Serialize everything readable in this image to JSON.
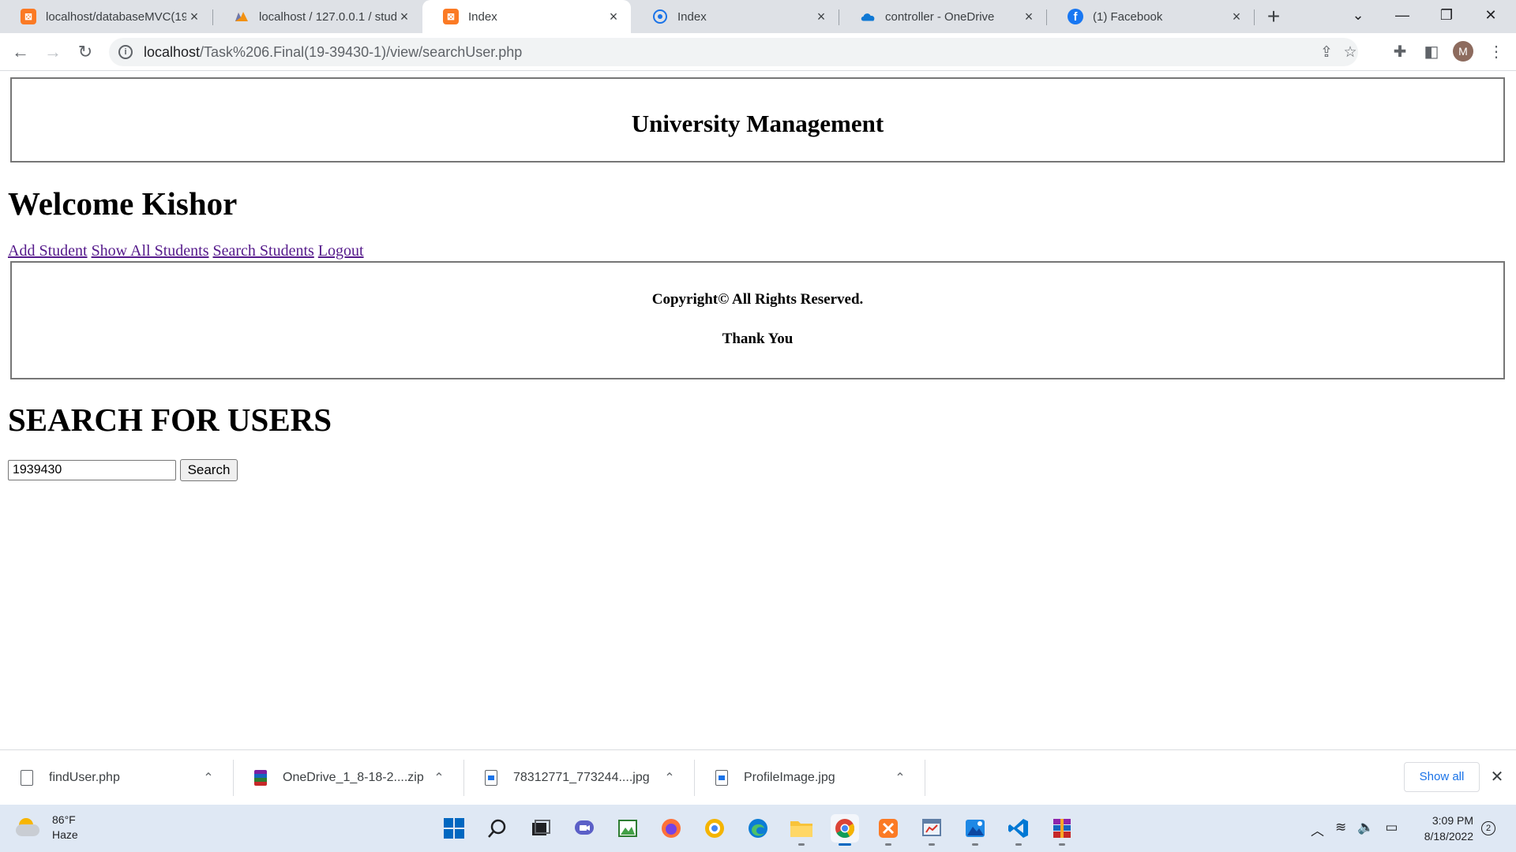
{
  "browser": {
    "tabs": [
      {
        "title": "localhost/databaseMVC(19-",
        "favicon": "xampp-icon"
      },
      {
        "title": "localhost / 127.0.0.1 / stude",
        "favicon": "phpmyadmin-icon"
      },
      {
        "title": "Index",
        "favicon": "xampp-icon",
        "active": true
      },
      {
        "title": "Index",
        "favicon": "globe-icon"
      },
      {
        "title": "controller - OneDrive",
        "favicon": "onedrive-icon"
      },
      {
        "title": "(1) Facebook",
        "favicon": "facebook-icon"
      }
    ],
    "url_host": "localhost",
    "url_path": "/Task%206.Final(19-39430-1)/view/searchUser.php",
    "profile_initial": "M",
    "accent": "#1a73e8"
  },
  "page": {
    "header_title": "University Management",
    "welcome": "Welcome Kishor",
    "nav": {
      "add_student": "Add Student",
      "show_all": "Show All Students",
      "search": "Search Students",
      "logout": "Logout"
    },
    "footer": {
      "copyright": "Copyright© All Rights Reserved.",
      "thanks": "Thank You"
    },
    "search_title": "SEARCH FOR USERS",
    "search_value": "1939430",
    "search_button": "Search"
  },
  "downloads": {
    "items": [
      {
        "name": "findUser.php"
      },
      {
        "name": "OneDrive_1_8-18-2....zip"
      },
      {
        "name": "78312771_773244....jpg"
      },
      {
        "name": "ProfileImage.jpg"
      }
    ],
    "show_all": "Show all"
  },
  "taskbar": {
    "weather_temp": "86°F",
    "weather_desc": "Haze",
    "time": "3:09 PM",
    "date": "8/18/2022",
    "notifications": "2"
  }
}
